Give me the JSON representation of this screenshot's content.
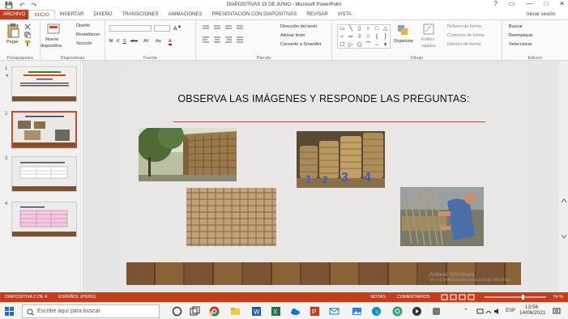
{
  "window": {
    "title": "DIAPOSITIVAS 15 DE JUNIO - Microsoft PowerPoint",
    "qat": {
      "save": "💾",
      "undo": "↶",
      "redo": "↷"
    },
    "controls": {
      "help": "?",
      "restore": "▭",
      "minimize": "—",
      "maximize": "□",
      "close": "✕"
    }
  },
  "tabs": [
    {
      "label": "ARCHIVO"
    },
    {
      "label": "INICIO"
    },
    {
      "label": "INSERTAR"
    },
    {
      "label": "DISEÑO"
    },
    {
      "label": "TRANSICIONES"
    },
    {
      "label": "ANIMACIONES"
    },
    {
      "label": "PRESENTACIÓN CON DIAPOSITIVAS"
    },
    {
      "label": "REVISAR"
    },
    {
      "label": "VISTA"
    }
  ],
  "signin": "Iniciar sesión",
  "ribbon": {
    "portapapeles": {
      "pegar": "Pegar",
      "label": "Portapapeles"
    },
    "diapositivas": {
      "nueva": "Nueva",
      "nueva2": "diapositiva",
      "diseno": "Diseño",
      "restablecer": "Restablecer",
      "seccion": "Sección",
      "label": "Diapositivas"
    },
    "fuente": {
      "label": "Fuente",
      "buttons": [
        "N",
        "K",
        "S",
        "abc",
        "AV",
        "Aa",
        "A"
      ]
    },
    "parrafo": {
      "direccion": "Dirección del texto",
      "alinear": "Alinear texto",
      "smartart": "Convertir a SmartArt",
      "label": "Párrafo"
    },
    "dibujo": {
      "organizar": "Organizar",
      "estilos": "Estilos",
      "estilos2": "rápidos",
      "relleno": "Relleno de forma",
      "contorno": "Contorno de forma",
      "efectos": "Efectos de forma",
      "label": "Dibujo",
      "shapes": [
        "▭",
        "╲",
        "▯",
        "○",
        "□",
        "△",
        "⌐",
        "⇨",
        "⇩",
        "☆",
        "{",
        "}",
        "☐",
        "▷",
        "⬠",
        "⌒",
        "⌣",
        "▾"
      ]
    },
    "edicion": {
      "buscar": "Buscar",
      "reemplazar": "Reemplazar",
      "seleccionar": "Seleccionar",
      "label": "Edición"
    }
  },
  "thumbnails": [
    {
      "num": "1",
      "star": "★"
    },
    {
      "num": "2"
    },
    {
      "num": "3"
    },
    {
      "num": "4"
    }
  ],
  "slide": {
    "title": "OBSERVA LAS IMÁGENES Y RESPONDE  LAS PREGUNTAS:",
    "basket_numbers": [
      "1",
      "2",
      "3",
      "4"
    ]
  },
  "status": {
    "slide": "DIAPOSITIVA 2 DE 4",
    "language": "ESPAÑOL (PERÚ)",
    "notes": "NOTAS",
    "comments": "COMENTARIOS",
    "zoom": "74 %"
  },
  "watermark": {
    "line1": "Activar Windows",
    "line2": "Ve a Configuración para activar Windows."
  },
  "taskbar": {
    "search_placeholder": "Escribe aquí para buscar",
    "time": "13:56",
    "date": "14/06/2021",
    "lang": "ESP"
  },
  "colors": {
    "accent": "#c43e1c",
    "slide_line": "#b45050"
  }
}
